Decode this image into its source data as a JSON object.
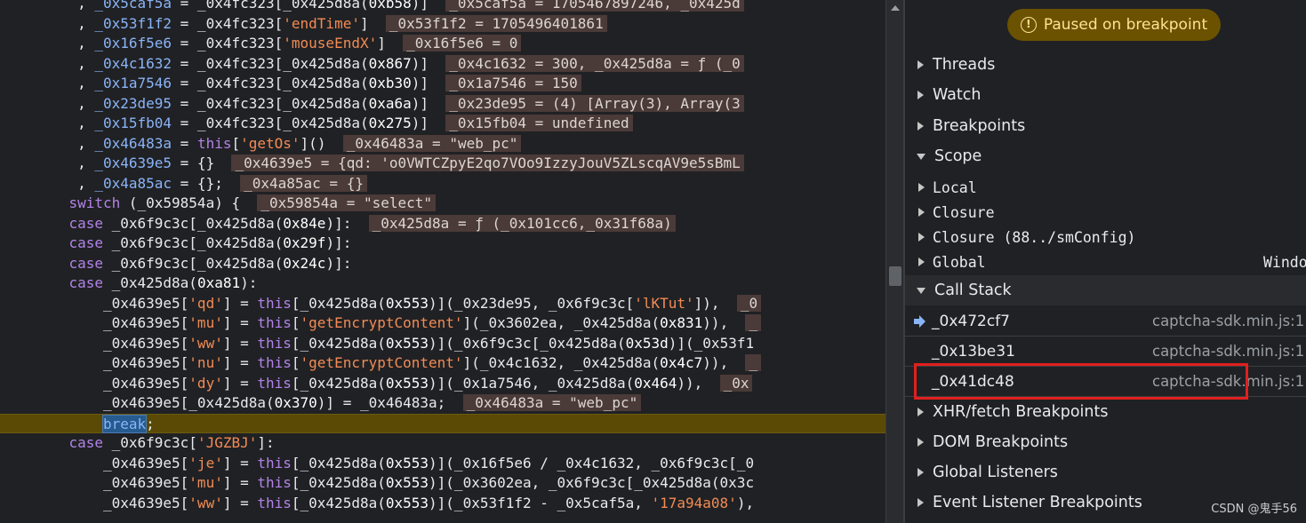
{
  "editor": {
    "lines": [
      [
        {
          "t": "        , ",
          "c": "plain"
        },
        {
          "t": "_0x5caf5a",
          "c": "ident"
        },
        {
          "t": " = _0x4fc323[_0x425d8a(",
          "c": "plain"
        },
        {
          "t": "0xb58",
          "c": "num"
        },
        {
          "t": ")]  ",
          "c": "plain"
        },
        {
          "t": "_0x5caf5a = 1705467897246, _0x425d",
          "c": "val"
        }
      ],
      [
        {
          "t": "        , ",
          "c": "plain"
        },
        {
          "t": "_0x53f1f2",
          "c": "ident"
        },
        {
          "t": " = _0x4fc323[",
          "c": "plain"
        },
        {
          "t": "'endTime'",
          "c": "str"
        },
        {
          "t": "]  ",
          "c": "plain"
        },
        {
          "t": "_0x53f1f2 = 1705496401861",
          "c": "val"
        }
      ],
      [
        {
          "t": "        , ",
          "c": "plain"
        },
        {
          "t": "_0x16f5e6",
          "c": "ident"
        },
        {
          "t": " = _0x4fc323[",
          "c": "plain"
        },
        {
          "t": "'mouseEndX'",
          "c": "str"
        },
        {
          "t": "]  ",
          "c": "plain"
        },
        {
          "t": "_0x16f5e6 = 0",
          "c": "val"
        }
      ],
      [
        {
          "t": "        , ",
          "c": "plain"
        },
        {
          "t": "_0x4c1632",
          "c": "ident"
        },
        {
          "t": " = _0x4fc323[_0x425d8a(",
          "c": "plain"
        },
        {
          "t": "0x867",
          "c": "num"
        },
        {
          "t": ")]  ",
          "c": "plain"
        },
        {
          "t": "_0x4c1632 = 300, _0x425d8a = ƒ (_0",
          "c": "val"
        }
      ],
      [
        {
          "t": "        , ",
          "c": "plain"
        },
        {
          "t": "_0x1a7546",
          "c": "ident"
        },
        {
          "t": " = _0x4fc323[_0x425d8a(",
          "c": "plain"
        },
        {
          "t": "0xb30",
          "c": "num"
        },
        {
          "t": ")]  ",
          "c": "plain"
        },
        {
          "t": "_0x1a7546 = 150",
          "c": "val"
        }
      ],
      [
        {
          "t": "        , ",
          "c": "plain"
        },
        {
          "t": "_0x23de95",
          "c": "ident"
        },
        {
          "t": " = _0x4fc323[_0x425d8a(",
          "c": "plain"
        },
        {
          "t": "0xa6a",
          "c": "num"
        },
        {
          "t": ")]  ",
          "c": "plain"
        },
        {
          "t": "_0x23de95 = (4) [Array(3), Array(3",
          "c": "val"
        }
      ],
      [
        {
          "t": "        , ",
          "c": "plain"
        },
        {
          "t": "_0x15fb04",
          "c": "ident"
        },
        {
          "t": " = _0x4fc323[_0x425d8a(",
          "c": "plain"
        },
        {
          "t": "0x275",
          "c": "num"
        },
        {
          "t": ")]  ",
          "c": "plain"
        },
        {
          "t": "_0x15fb04 = undefined",
          "c": "val"
        }
      ],
      [
        {
          "t": "        , ",
          "c": "plain"
        },
        {
          "t": "_0x46483a",
          "c": "ident"
        },
        {
          "t": " = ",
          "c": "plain"
        },
        {
          "t": "this",
          "c": "kw"
        },
        {
          "t": "[",
          "c": "plain"
        },
        {
          "t": "'getOs'",
          "c": "str"
        },
        {
          "t": "]()  ",
          "c": "plain"
        },
        {
          "t": "_0x46483a = \"web_pc\"",
          "c": "val"
        }
      ],
      [
        {
          "t": "        , ",
          "c": "plain"
        },
        {
          "t": "_0x4639e5",
          "c": "ident"
        },
        {
          "t": " = {}  ",
          "c": "plain"
        },
        {
          "t": "_0x4639e5 = {qd: 'o0VWTCZpyE2qo7VOo9IzzyJouV5ZLscqAV9e5sBmL",
          "c": "val"
        }
      ],
      [
        {
          "t": "        , ",
          "c": "plain"
        },
        {
          "t": "_0x4a85ac",
          "c": "ident"
        },
        {
          "t": " = {};  ",
          "c": "plain"
        },
        {
          "t": "_0x4a85ac = {}",
          "c": "val"
        }
      ],
      [
        {
          "t": "       ",
          "c": "plain"
        },
        {
          "t": "switch",
          "c": "kw"
        },
        {
          "t": " (_0x59854a) {  ",
          "c": "plain"
        },
        {
          "t": "_0x59854a = \"select\"",
          "c": "val"
        }
      ],
      [
        {
          "t": "       ",
          "c": "plain"
        },
        {
          "t": "case",
          "c": "kw"
        },
        {
          "t": " _0x6f9c3c[_0x425d8a(",
          "c": "plain"
        },
        {
          "t": "0x84e",
          "c": "num"
        },
        {
          "t": ")]:  ",
          "c": "plain"
        },
        {
          "t": "_0x425d8a = ƒ (_0x101cc6,_0x31f68a)",
          "c": "val"
        }
      ],
      [
        {
          "t": "       ",
          "c": "plain"
        },
        {
          "t": "case",
          "c": "kw"
        },
        {
          "t": " _0x6f9c3c[_0x425d8a(",
          "c": "plain"
        },
        {
          "t": "0x29f",
          "c": "num"
        },
        {
          "t": ")]:",
          "c": "plain"
        }
      ],
      [
        {
          "t": "       ",
          "c": "plain"
        },
        {
          "t": "case",
          "c": "kw"
        },
        {
          "t": " _0x6f9c3c[_0x425d8a(",
          "c": "plain"
        },
        {
          "t": "0x24c",
          "c": "num"
        },
        {
          "t": ")]:",
          "c": "plain"
        }
      ],
      [
        {
          "t": "       ",
          "c": "plain"
        },
        {
          "t": "case",
          "c": "kw"
        },
        {
          "t": " _0x425d8a(",
          "c": "plain"
        },
        {
          "t": "0xa81",
          "c": "num"
        },
        {
          "t": "):",
          "c": "plain"
        }
      ],
      [
        {
          "t": "           _0x4639e5[",
          "c": "plain"
        },
        {
          "t": "'qd'",
          "c": "str"
        },
        {
          "t": "] = ",
          "c": "plain"
        },
        {
          "t": "this",
          "c": "kw"
        },
        {
          "t": "[_0x425d8a(",
          "c": "plain"
        },
        {
          "t": "0x553",
          "c": "num"
        },
        {
          "t": ")](_0x23de95, _0x6f9c3c[",
          "c": "plain"
        },
        {
          "t": "'lKTut'",
          "c": "str"
        },
        {
          "t": "]),  ",
          "c": "plain"
        },
        {
          "t": "_0",
          "c": "val"
        }
      ],
      [
        {
          "t": "           _0x4639e5[",
          "c": "plain"
        },
        {
          "t": "'mu'",
          "c": "str"
        },
        {
          "t": "] = ",
          "c": "plain"
        },
        {
          "t": "this",
          "c": "kw"
        },
        {
          "t": "[",
          "c": "plain"
        },
        {
          "t": "'getEncryptContent'",
          "c": "str"
        },
        {
          "t": "](_0x3602ea, _0x425d8a(",
          "c": "plain"
        },
        {
          "t": "0x831",
          "c": "num"
        },
        {
          "t": ")),  ",
          "c": "plain"
        },
        {
          "t": "_",
          "c": "val"
        }
      ],
      [
        {
          "t": "           _0x4639e5[",
          "c": "plain"
        },
        {
          "t": "'ww'",
          "c": "str"
        },
        {
          "t": "] = ",
          "c": "plain"
        },
        {
          "t": "this",
          "c": "kw"
        },
        {
          "t": "[_0x425d8a(",
          "c": "plain"
        },
        {
          "t": "0x553",
          "c": "num"
        },
        {
          "t": ")](_0x6f9c3c[_0x425d8a(",
          "c": "plain"
        },
        {
          "t": "0x53d",
          "c": "num"
        },
        {
          "t": ")](_0x53f1",
          "c": "plain"
        }
      ],
      [
        {
          "t": "           _0x4639e5[",
          "c": "plain"
        },
        {
          "t": "'nu'",
          "c": "str"
        },
        {
          "t": "] = ",
          "c": "plain"
        },
        {
          "t": "this",
          "c": "kw"
        },
        {
          "t": "[",
          "c": "plain"
        },
        {
          "t": "'getEncryptContent'",
          "c": "str"
        },
        {
          "t": "](_0x4c1632, _0x425d8a(",
          "c": "plain"
        },
        {
          "t": "0x4c7",
          "c": "num"
        },
        {
          "t": ")),  ",
          "c": "plain"
        },
        {
          "t": "_",
          "c": "val"
        }
      ],
      [
        {
          "t": "           _0x4639e5[",
          "c": "plain"
        },
        {
          "t": "'dy'",
          "c": "str"
        },
        {
          "t": "] = ",
          "c": "plain"
        },
        {
          "t": "this",
          "c": "kw"
        },
        {
          "t": "[_0x425d8a(",
          "c": "plain"
        },
        {
          "t": "0x553",
          "c": "num"
        },
        {
          "t": ")](_0x1a7546, _0x425d8a(",
          "c": "plain"
        },
        {
          "t": "0x464",
          "c": "num"
        },
        {
          "t": ")),  ",
          "c": "plain"
        },
        {
          "t": "_0x",
          "c": "val"
        }
      ],
      [
        {
          "t": "           _0x4639e5[_0x425d8a(",
          "c": "plain"
        },
        {
          "t": "0x370",
          "c": "num"
        },
        {
          "t": ")] = _0x46483a;  ",
          "c": "plain"
        },
        {
          "t": "_0x46483a = \"web_pc\"",
          "c": "val"
        }
      ],
      [
        {
          "t": "           ",
          "c": "plain"
        },
        {
          "t": "break",
          "c": "breakhl"
        },
        {
          "t": ";",
          "c": "plain"
        }
      ],
      [
        {
          "t": "       ",
          "c": "plain"
        },
        {
          "t": "case",
          "c": "kw"
        },
        {
          "t": " _0x6f9c3c[",
          "c": "plain"
        },
        {
          "t": "'JGZBJ'",
          "c": "str"
        },
        {
          "t": "]:",
          "c": "plain"
        }
      ],
      [
        {
          "t": "           _0x4639e5[",
          "c": "plain"
        },
        {
          "t": "'je'",
          "c": "str"
        },
        {
          "t": "] = ",
          "c": "plain"
        },
        {
          "t": "this",
          "c": "kw"
        },
        {
          "t": "[_0x425d8a(",
          "c": "plain"
        },
        {
          "t": "0x553",
          "c": "num"
        },
        {
          "t": ")](_0x16f5e6 / _0x4c1632, _0x6f9c3c[_0",
          "c": "plain"
        }
      ],
      [
        {
          "t": "           _0x4639e5[",
          "c": "plain"
        },
        {
          "t": "'mu'",
          "c": "str"
        },
        {
          "t": "] = ",
          "c": "plain"
        },
        {
          "t": "this",
          "c": "kw"
        },
        {
          "t": "[_0x425d8a(",
          "c": "plain"
        },
        {
          "t": "0x553",
          "c": "num"
        },
        {
          "t": ")](_0x3602ea, _0x6f9c3c[_0x425d8a(0x3c",
          "c": "plain"
        }
      ],
      [
        {
          "t": "           _0x4639e5[",
          "c": "plain"
        },
        {
          "t": "'ww'",
          "c": "str"
        },
        {
          "t": "] = ",
          "c": "plain"
        },
        {
          "t": "this",
          "c": "kw"
        },
        {
          "t": "[_0x425d8a(",
          "c": "plain"
        },
        {
          "t": "0x553",
          "c": "num"
        },
        {
          "t": ")](_0x53f1f2 - _0x5caf5a, ",
          "c": "plain"
        },
        {
          "t": "'17a94a08'",
          "c": "str"
        },
        {
          "t": "),",
          "c": "plain"
        }
      ]
    ],
    "current_line_index": 21
  },
  "debugger": {
    "pause_banner": "Paused on breakpoint",
    "sections": {
      "threads": "Threads",
      "watch": "Watch",
      "breakpoints": "Breakpoints",
      "scope": "Scope",
      "call_stack": "Call Stack",
      "xhr_breakpoints": "XHR/fetch Breakpoints",
      "dom_breakpoints": "DOM Breakpoints",
      "global_listeners": "Global Listeners",
      "event_listener_breakpoints": "Event Listener Breakpoints"
    },
    "scope_items": [
      {
        "name": "Local",
        "value": ""
      },
      {
        "name": "Closure",
        "value": ""
      },
      {
        "name": "Closure (88../smConfig)",
        "value": ""
      },
      {
        "name": "Global",
        "value": "Windo"
      }
    ],
    "call_stack": [
      {
        "fn": "_0x472cf7",
        "loc": "captcha-sdk.min.js:1",
        "current": true
      },
      {
        "fn": "_0x13be31",
        "loc": "captcha-sdk.min.js:1",
        "current": false
      },
      {
        "fn": "_0x41dc48",
        "loc": "captcha-sdk.min.js:1",
        "current": false
      }
    ]
  },
  "watermark": "CSDN @鬼手56",
  "colors": {
    "editor_bg": "#202124",
    "current_line": "#5a4a05",
    "keyword": "#b283e8",
    "identifier": "#8ab4f8",
    "string": "#f28b54",
    "highlight_box": "#e0201e",
    "pause_banner": "#6b5200"
  }
}
